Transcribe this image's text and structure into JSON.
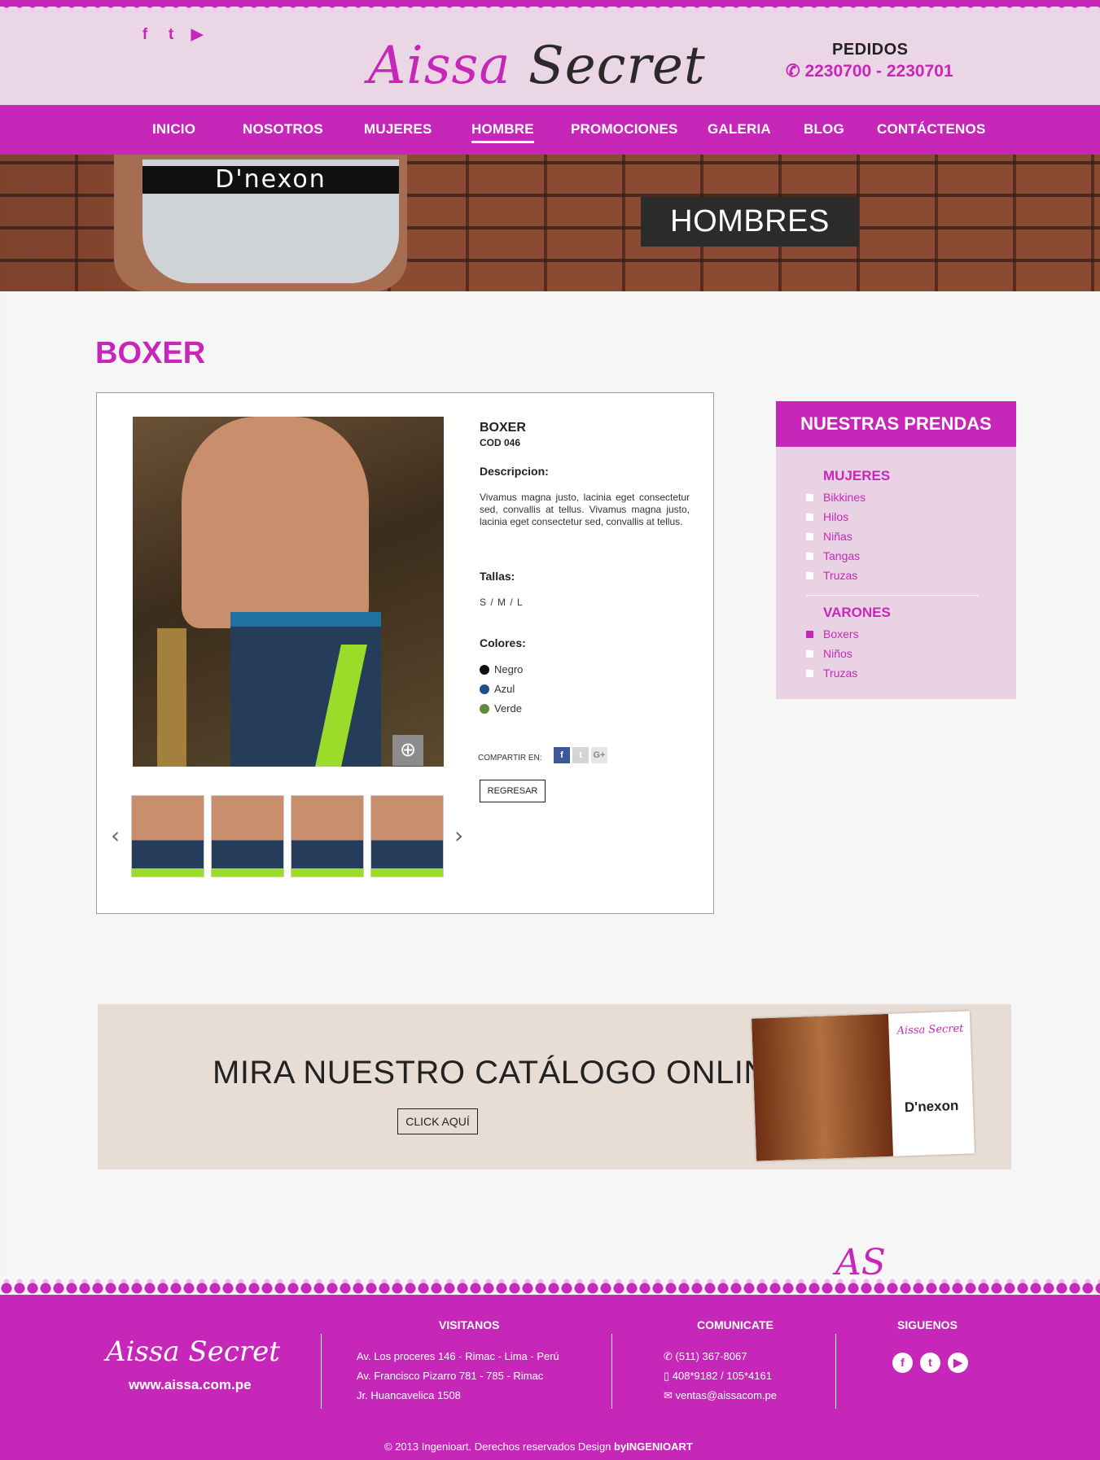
{
  "header": {
    "social": [
      {
        "icon": "facebook-icon",
        "glyph": "f"
      },
      {
        "icon": "twitter-icon",
        "glyph": "t"
      },
      {
        "icon": "youtube-icon",
        "glyph": "▶"
      }
    ],
    "logo_part1": "Aissa",
    "logo_part2": "Secret",
    "orders_title": "PEDIDOS",
    "orders_phones": "2230700 -  2230701"
  },
  "nav": {
    "items": [
      "INICIO",
      "NOSOTROS",
      "MUJERES",
      "HOMBRE",
      "PROMOCIONES",
      "GALERIA",
      "BLOG",
      "CONTÁCTENOS"
    ],
    "active": "HOMBRE"
  },
  "hero": {
    "band_text": "D'nexon",
    "label": "HOMBRES"
  },
  "page": {
    "title": "BOXER"
  },
  "product": {
    "name": "BOXER",
    "code": "COD 046",
    "desc_label": "Descripcion:",
    "description": "Vivamus magna justo, lacinia eget consectetur sed, convallis at tellus. Vivamus magna justo, lacinia eget consectetur sed, convallis at tellus.",
    "sizes_label": "Tallas:",
    "sizes": "S  /  M  /  L",
    "colors_label": "Colores:",
    "colors": [
      {
        "name": "Negro",
        "hex": "#111111"
      },
      {
        "name": "Azul",
        "hex": "#1f4e8c"
      },
      {
        "name": "Verde",
        "hex": "#5f8a3a"
      }
    ],
    "share_label": "COMPARTIR EN:",
    "share_icons": [
      {
        "icon": "facebook-icon",
        "glyph": "f",
        "color": "#3b5998"
      },
      {
        "icon": "twitter-icon",
        "glyph": "t",
        "color": "#d4d4d4"
      },
      {
        "icon": "google-plus-icon",
        "glyph": "G+",
        "color": "#e6e6e6"
      }
    ],
    "back_label": "REGRESAR",
    "zoom_glyph": "⊕",
    "prev_glyph": "‹",
    "next_glyph": "›"
  },
  "sidebar": {
    "title": "NUESTRAS PRENDAS",
    "categories": [
      {
        "name": "MUJERES",
        "items": [
          "Bikkines",
          "Hilos",
          "Niñas",
          "Tangas",
          "Truzas"
        ],
        "selected": null
      },
      {
        "name": "VARONES",
        "items": [
          "Boxers",
          "Niños",
          "Truzas"
        ],
        "selected": "Boxers"
      }
    ]
  },
  "catalog": {
    "text": "MIRA NUESTRO CATÁLOGO ONLINE",
    "button": "CLICK AQUÍ",
    "logo": "Aissa Secret",
    "brand": "D'nexon"
  },
  "footer": {
    "monogram": "AS",
    "logo": "Aissa Secret",
    "url": "www.aissa.com.pe",
    "visit_title": "VISITANOS",
    "addresses": [
      "Av. Los proceres 146 - Rimac - Lima - Perú",
      "Av. Francisco Pizarro 781 - 785 - Rimac",
      "Jr. Huancavelica 1508"
    ],
    "contact_title": "COMUNICATE",
    "contacts": [
      {
        "icon": "phone-icon",
        "glyph": "✆",
        "text": "(511) 367-8067"
      },
      {
        "icon": "mobile-icon",
        "glyph": "▯",
        "text": "408*9182 / 105*4161"
      },
      {
        "icon": "mail-icon",
        "glyph": "✉",
        "text": "ventas@aissacom.pe"
      }
    ],
    "follow_title": "SIGUENOS",
    "social": [
      {
        "icon": "facebook-icon",
        "glyph": "f"
      },
      {
        "icon": "twitter-icon",
        "glyph": "t"
      },
      {
        "icon": "youtube-icon",
        "glyph": "▶"
      }
    ],
    "copyright": "© 2013 Ingenioart. Derechos reservados Design ",
    "designer": "byINGENIOART"
  },
  "colors": {
    "brand": "#c727b9",
    "header_bg": "#ead6e4",
    "sidebar_bg": "#e9d2e4",
    "catalog_bg": "#e7ddd5"
  }
}
